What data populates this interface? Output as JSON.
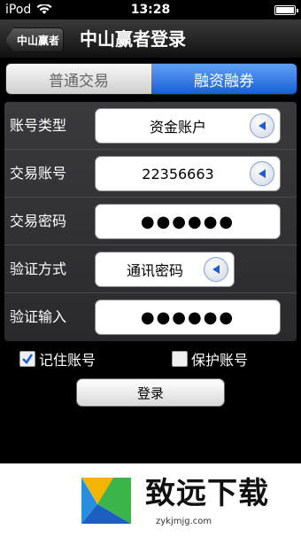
{
  "status": {
    "carrier": "iPod",
    "time": "13:28"
  },
  "nav": {
    "back_label": "中山赢者",
    "title": "中山赢者登录"
  },
  "segment": {
    "tabs": [
      "普通交易",
      "融资融券"
    ]
  },
  "form": {
    "rows": [
      {
        "label": "账号类型",
        "value": "资金账户"
      },
      {
        "label": "交易账号",
        "value": "22356663"
      },
      {
        "label": "交易密码",
        "value": "●●●●●●"
      },
      {
        "label": "验证方式",
        "value": "通讯密码"
      },
      {
        "label": "验证输入",
        "value": "●●●●●●"
      }
    ]
  },
  "checks": {
    "remember_label": "记住账号",
    "remember_checked": true,
    "protect_label": "保护账号",
    "protect_checked": false
  },
  "login": {
    "label": "登录"
  },
  "banner": {
    "title": "致远下载",
    "url": "zykjmjg.com"
  },
  "colors": {
    "accent": "#1a5fd6",
    "nav": "#222222",
    "panel": "#333335"
  }
}
